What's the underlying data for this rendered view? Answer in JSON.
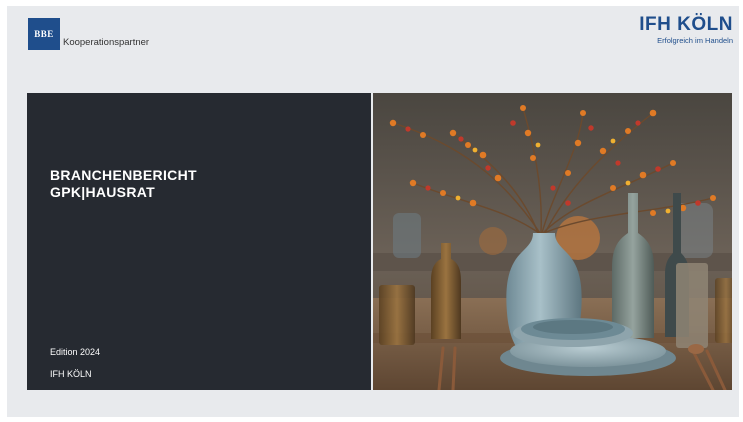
{
  "header": {
    "bbe_logo_text": "BBE",
    "partner_label": "Kooperationspartner",
    "ifh_name": "IFH KÖLN",
    "ifh_tagline": "Erfolgreich im Handeln"
  },
  "cover": {
    "title_line1": "BRANCHENBERICHT",
    "title_line2": "GPK|HAUSRAT",
    "edition": "Edition 2024",
    "publisher": "IFH KÖLN"
  },
  "colors": {
    "brand_blue": "#1f4e8c",
    "panel_dark": "#262a31",
    "background": "#e8eaed"
  }
}
